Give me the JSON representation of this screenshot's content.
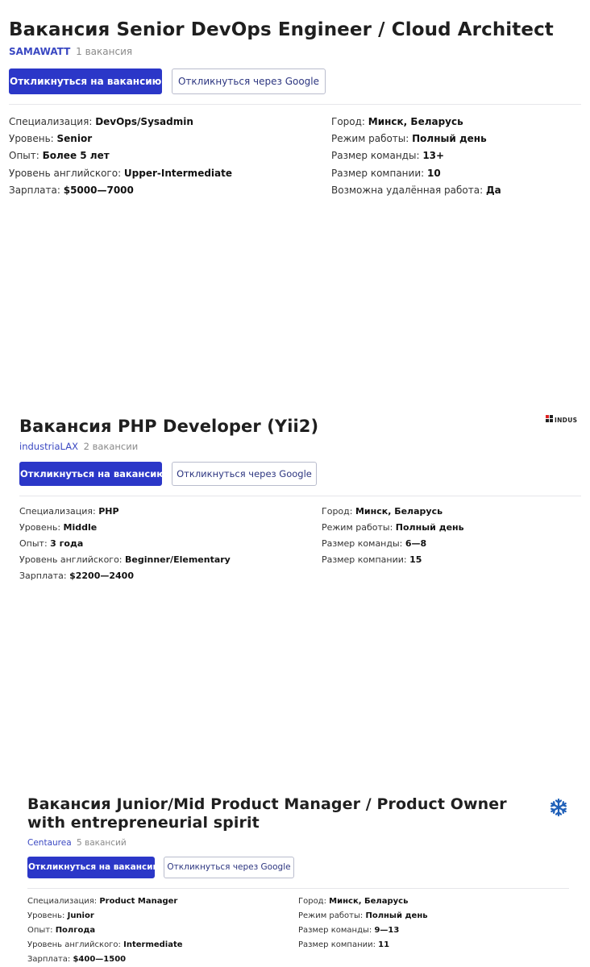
{
  "vacancies": [
    {
      "title": "Вакансия Senior DevOps Engineer / Cloud Architect",
      "company": "SAMAWATT",
      "vacancies_count": "1 вакансия",
      "apply_label": "Откликнуться на вакансию",
      "apply_google_label": "Откликнуться через Google",
      "left_details": [
        {
          "label": "Специализация: ",
          "value": "DevOps/Sysadmin"
        },
        {
          "label": "Уровень: ",
          "value": "Senior"
        },
        {
          "label": "Опыт: ",
          "value": "Более 5 лет"
        },
        {
          "label": "Уровень английского: ",
          "value": "Upper-Intermediate"
        },
        {
          "label": "Зарплата: ",
          "value": "$5000—7000"
        }
      ],
      "right_details": [
        {
          "label": "Город: ",
          "value": "Минск, Беларусь"
        },
        {
          "label": "Режим работы: ",
          "value": "Полный день"
        },
        {
          "label": "Размер команды: ",
          "value": "13+"
        },
        {
          "label": "Размер компании: ",
          "value": "10"
        },
        {
          "label": "Возможна удалённая работа: ",
          "value": "Да"
        }
      ]
    },
    {
      "title": "Вакансия PHP Developer (Yii2)",
      "company": "industriaLAX",
      "vacancies_count": "2 вакансии",
      "apply_label": "Откликнуться на вакансию",
      "apply_google_label": "Откликнуться через Google",
      "logo_text": "INDUS",
      "left_details": [
        {
          "label": "Специализация: ",
          "value": "PHP"
        },
        {
          "label": "Уровень: ",
          "value": "Middle"
        },
        {
          "label": "Опыт: ",
          "value": "3 года"
        },
        {
          "label": "Уровень английского: ",
          "value": "Beginner/Elementary"
        },
        {
          "label": "Зарплата: ",
          "value": "$2200—2400"
        }
      ],
      "right_details": [
        {
          "label": "Город: ",
          "value": "Минск, Беларусь"
        },
        {
          "label": "Режим работы: ",
          "value": "Полный день"
        },
        {
          "label": "Размер команды: ",
          "value": "6—8"
        },
        {
          "label": "Размер компании: ",
          "value": "15"
        }
      ]
    },
    {
      "title": "Вакансия Junior/Mid Product Manager / Product Owner with entrepreneurial spirit",
      "company": "Centaurea",
      "vacancies_count": "5 вакансий",
      "apply_label": "Откликнуться на вакансию",
      "apply_google_label": "Откликнуться через Google",
      "left_details": [
        {
          "label": "Специализация: ",
          "value": "Product Manager"
        },
        {
          "label": "Уровень: ",
          "value": "Junior"
        },
        {
          "label": "Опыт: ",
          "value": "Полгода"
        },
        {
          "label": "Уровень английского: ",
          "value": "Intermediate"
        },
        {
          "label": "Зарплата: ",
          "value": "$400—1500"
        }
      ],
      "right_details": [
        {
          "label": "Город: ",
          "value": "Минск, Беларусь"
        },
        {
          "label": "Режим работы: ",
          "value": "Полный день"
        },
        {
          "label": "Размер команды: ",
          "value": "9—13"
        },
        {
          "label": "Размер компании: ",
          "value": "11"
        }
      ]
    }
  ],
  "colors": {
    "primary": "#2b37c8",
    "link": "#3a48c2",
    "muted": "#8a8a8a",
    "snowflake": "#1e5fb8"
  },
  "icons": {
    "card_1_logo": "indus-logo",
    "card_2_logo": "snowflake-icon"
  }
}
